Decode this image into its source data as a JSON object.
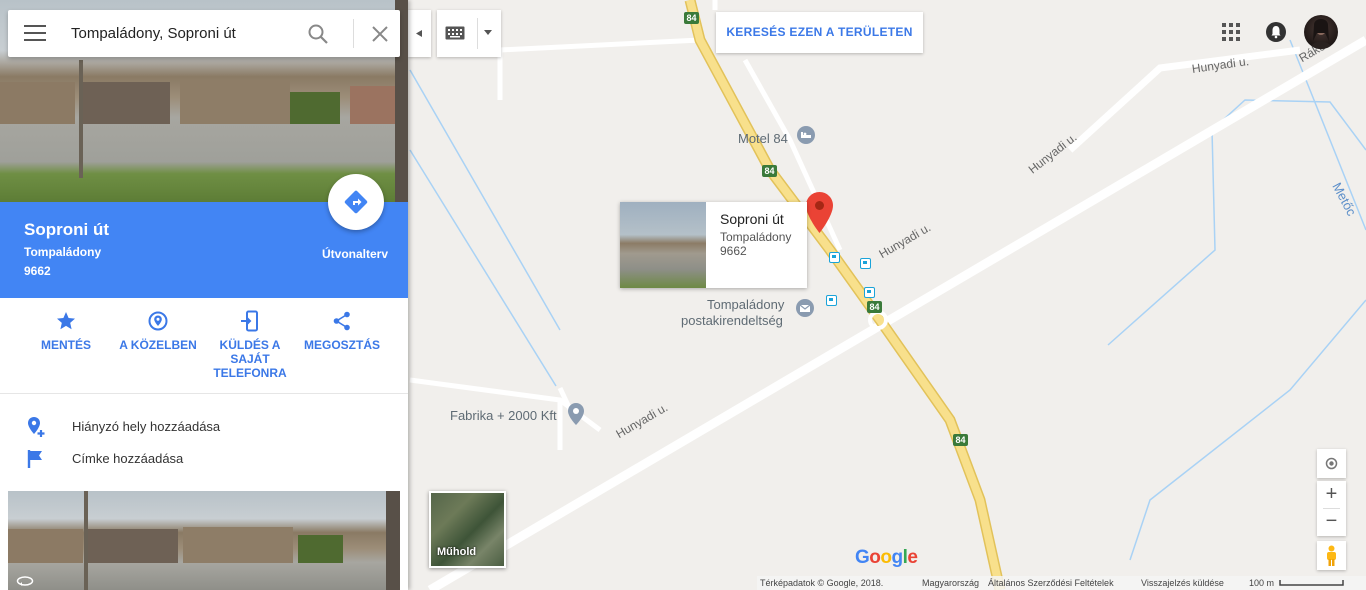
{
  "search": {
    "value": "Tompaládony, Soproni út"
  },
  "place": {
    "title": "Soproni út",
    "city": "Tompaládony",
    "zip": "9662",
    "route_label": "Útvonalterv"
  },
  "actions": [
    {
      "label": "MENTÉS",
      "icon": "star-icon"
    },
    {
      "label": "A KÖZELBEN",
      "icon": "nearby-icon"
    },
    {
      "label": "KÜLDÉS A SAJÁT TELEFONRA",
      "icon": "send-to-phone-icon"
    },
    {
      "label": "MEGOSZTÁS",
      "icon": "share-icon"
    }
  ],
  "links": [
    {
      "label": "Hiányzó hely hozzáadása",
      "icon": "add-place-icon"
    },
    {
      "label": "Címke hozzáadása",
      "icon": "flag-icon"
    }
  ],
  "map": {
    "area_search_label": "KERESÉS EZEN A TERÜLETEN",
    "labels": {
      "motel": "Motel 84",
      "post_office_line1": "Tompaládony",
      "post_office_line2": "postakirendeltség",
      "fabrika": "Fabrika + 2000 Kft",
      "road_hunyadi": "Hunyadi u.",
      "road_rakoc": "Rákóc",
      "road_metoc": "Metőc",
      "highway": "84"
    },
    "satellite_label": "Műhold",
    "google_logo": "Google"
  },
  "card": {
    "title": "Soproni út",
    "city": "Tompaládony",
    "zip": "9662"
  },
  "footer": {
    "copyright": "Térképadatok © Google, 2018.",
    "country": "Magyarország",
    "terms": "Általános Szerződési Feltételek",
    "feedback": "Visszajelzés küldése",
    "scale": "100 m"
  },
  "colors": {
    "accent": "#4285f4",
    "action_blue": "#3b78e7",
    "pin_red": "#ea4335",
    "highway_yellow": "#f8e08c"
  }
}
